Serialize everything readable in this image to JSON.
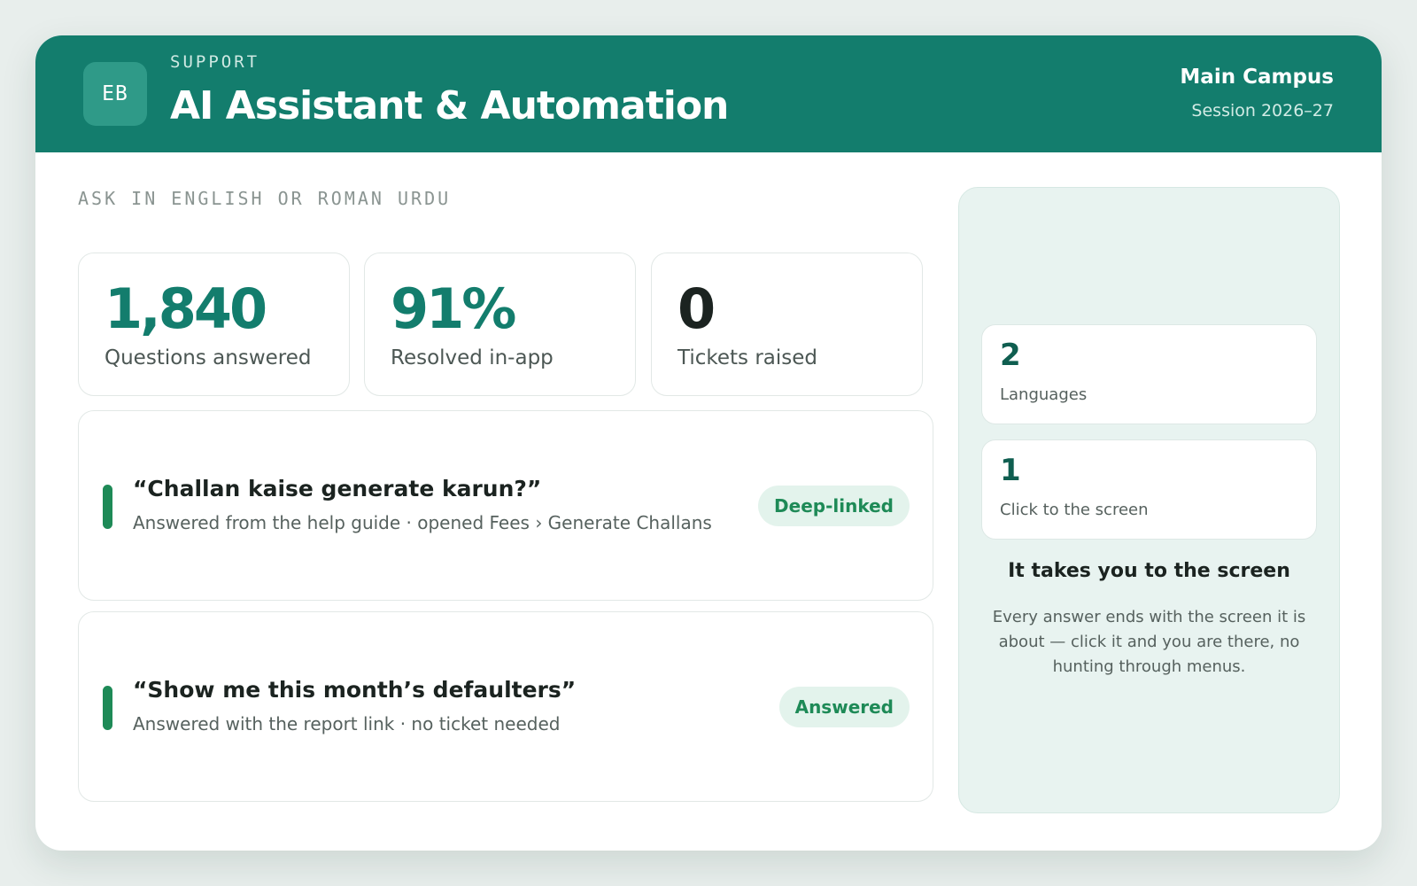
{
  "header": {
    "logo_initials": "EB",
    "eyebrow": "SUPPORT",
    "title": "AI Assistant & Automation",
    "campus": "Main Campus",
    "session": "Session 2026–27"
  },
  "main": {
    "section_label": "ASK IN ENGLISH OR ROMAN URDU",
    "stats": [
      {
        "value": "1,840",
        "label": "Questions answered"
      },
      {
        "value": "91%",
        "label": "Resolved in-app"
      },
      {
        "value": "0",
        "label": "Tickets raised"
      }
    ],
    "questions": [
      {
        "question": "“Challan kaise generate karun?”",
        "detail": "Answered from the help guide · opened Fees › Generate Challans",
        "badge": "Deep-linked"
      },
      {
        "question": "“Show me this month’s defaulters”",
        "detail": "Answered with the report link · no ticket needed",
        "badge": "Answered"
      }
    ]
  },
  "side_panel": {
    "stats": [
      {
        "value": "2",
        "label": "Languages"
      },
      {
        "value": "1",
        "label": "Click to the screen"
      }
    ],
    "title": "It takes you to the screen",
    "body": "Every answer ends with the screen it is about — click it and you are there, no hunting through menus."
  },
  "colors": {
    "brand": "#137d6d",
    "accent_green": "#1e8a57",
    "badge_bg": "#e3f3ec",
    "panel_bg": "#e8f3f0"
  }
}
